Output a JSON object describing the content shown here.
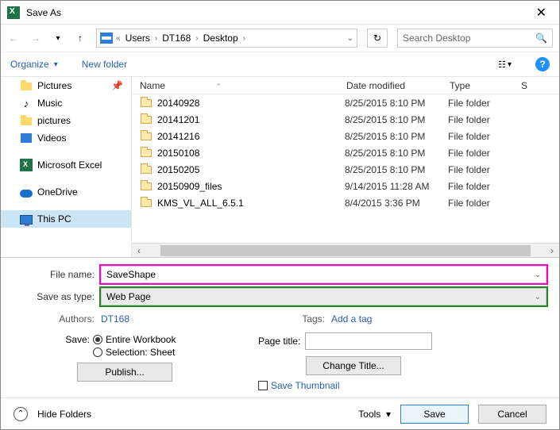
{
  "title": "Save As",
  "nav": {
    "breadcrumb": [
      "Users",
      "DT168",
      "Desktop"
    ]
  },
  "search": {
    "placeholder": "Search Desktop"
  },
  "toolbar": {
    "organize": "Organize",
    "newfolder": "New folder"
  },
  "sidebar": {
    "items": [
      {
        "label": "Pictures",
        "icon": "folder-sm",
        "pinned": true
      },
      {
        "label": "Music",
        "icon": "note"
      },
      {
        "label": "pictures",
        "icon": "folder-sm"
      },
      {
        "label": "Videos",
        "icon": "videos"
      },
      {
        "label": "Microsoft Excel",
        "icon": "excel",
        "gap": true
      },
      {
        "label": "OneDrive",
        "icon": "onedrive",
        "gap": true
      },
      {
        "label": "This PC",
        "icon": "pc",
        "gap": true,
        "selected": true
      }
    ]
  },
  "columns": {
    "name": "Name",
    "date": "Date modified",
    "type": "Type",
    "size": "S"
  },
  "files": [
    {
      "name": "20140928",
      "date": "8/25/2015 8:10 PM",
      "type": "File folder"
    },
    {
      "name": "20141201",
      "date": "8/25/2015 8:10 PM",
      "type": "File folder"
    },
    {
      "name": "20141216",
      "date": "8/25/2015 8:10 PM",
      "type": "File folder"
    },
    {
      "name": "20150108",
      "date": "8/25/2015 8:10 PM",
      "type": "File folder"
    },
    {
      "name": "20150205",
      "date": "8/25/2015 8:10 PM",
      "type": "File folder"
    },
    {
      "name": "20150909_files",
      "date": "9/14/2015 11:28 AM",
      "type": "File folder"
    },
    {
      "name": "KMS_VL_ALL_6.5.1",
      "date": "8/4/2015 3:36 PM",
      "type": "File folder"
    }
  ],
  "form": {
    "filename_label": "File name:",
    "filename": "SaveShape",
    "savetype_label": "Save as type:",
    "savetype": "Web Page",
    "authors_label": "Authors:",
    "authors": "DT168",
    "tags_label": "Tags:",
    "tags": "Add a tag"
  },
  "save_section": {
    "label": "Save:",
    "opt_workbook": "Entire Workbook",
    "opt_selection": "Selection: Sheet",
    "publish": "Publish..."
  },
  "page_section": {
    "pagetitle_label": "Page title:",
    "changetitle": "Change Title...",
    "savethumb": "Save Thumbnail"
  },
  "footer": {
    "hidefolders": "Hide Folders",
    "tools": "Tools",
    "save": "Save",
    "cancel": "Cancel"
  }
}
